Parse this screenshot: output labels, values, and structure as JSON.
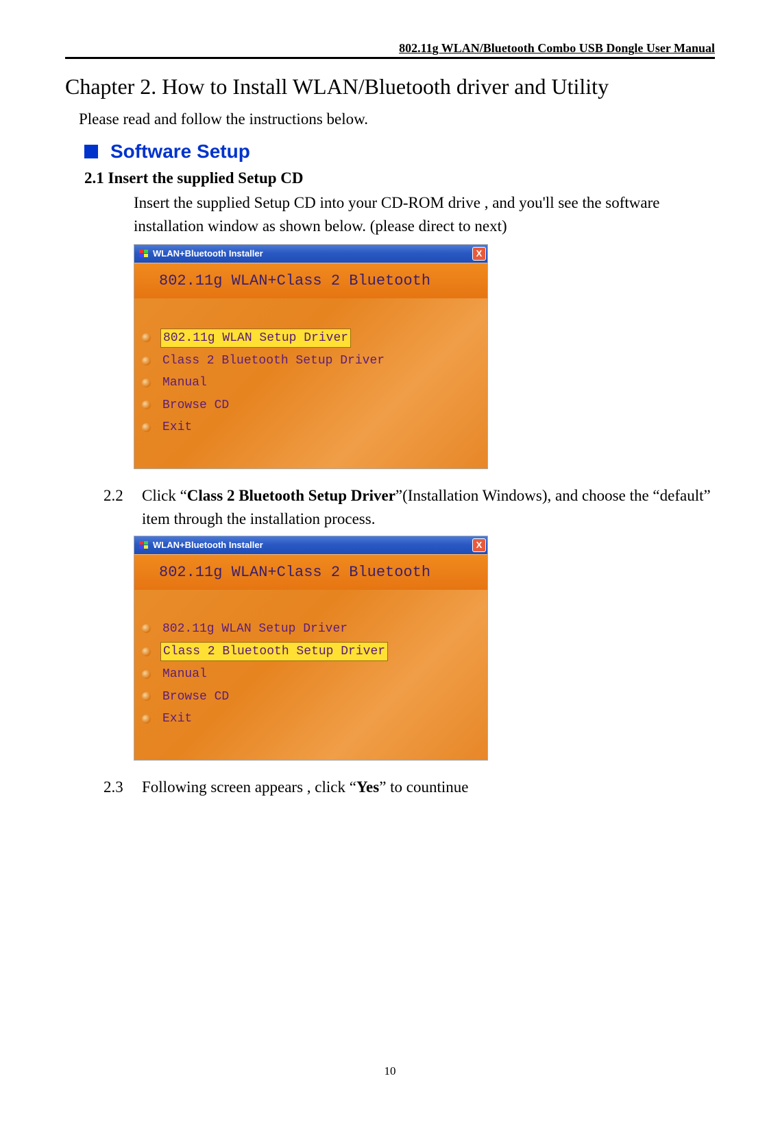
{
  "header": "802.11g WLAN/Bluetooth Combo USB Dongle User Manual",
  "chapter_title": "Chapter 2. How to Install WLAN/Bluetooth driver and Utility",
  "chapter_intro": "Please read and follow the instructions below.",
  "section_title": "Software Setup",
  "step_2_1": {
    "title": "2.1 Insert the supplied Setup CD",
    "body": "Insert the supplied Setup CD into your CD-ROM drive , and you'll see the software installation window as shown below. (please direct to next)"
  },
  "step_2_2": {
    "num": "2.2",
    "body_pre": "Click “",
    "body_bold": "Class 2 Bluetooth Setup Driver",
    "body_post": "”(Installation Windows), and choose the “default” item through the installation process."
  },
  "step_2_3": {
    "num": "2.3",
    "body_pre": "Following screen appears , click “",
    "body_bold": "Yes",
    "body_post": "” to countinue"
  },
  "installer": {
    "title": "WLAN+Bluetooth Installer",
    "banner": "802.11g WLAN+Class 2 Bluetooth",
    "close": "X",
    "items": [
      "802.11g WLAN Setup Driver",
      "Class 2 Bluetooth Setup Driver",
      "Manual",
      "Browse CD",
      "Exit"
    ]
  },
  "page_number": "10"
}
